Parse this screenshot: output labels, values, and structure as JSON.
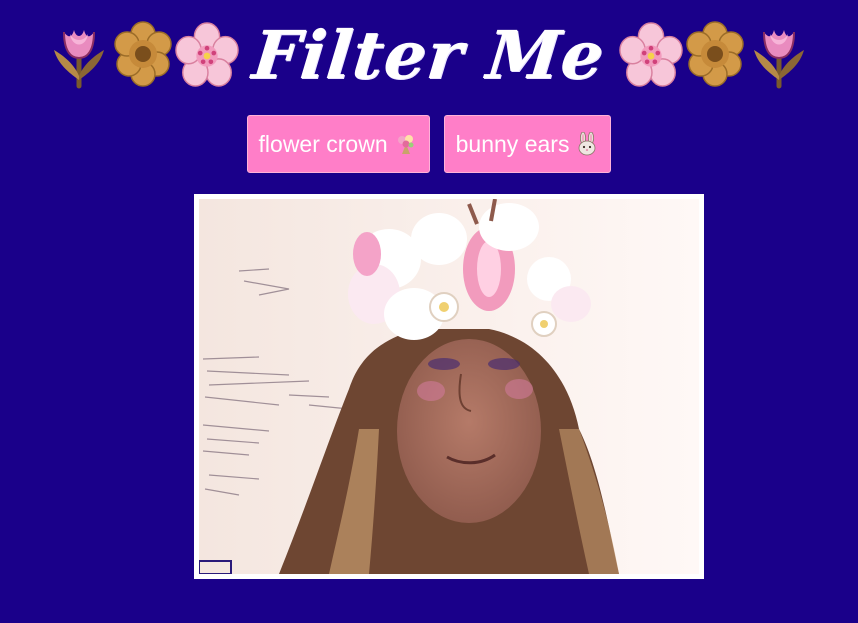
{
  "app": {
    "title": "Filter Me"
  },
  "header": {
    "left_decorations": [
      "tulip-icon",
      "blossom-icon",
      "cherry-blossom-icon"
    ],
    "right_decorations": [
      "cherry-blossom-icon",
      "blossom-icon",
      "tulip-icon"
    ]
  },
  "filters": {
    "flower_crown": {
      "label": "flower crown",
      "icon": "bouquet-icon"
    },
    "bunny_ears": {
      "label": "bunny ears",
      "icon": "rabbit-face-icon"
    }
  },
  "video": {
    "active_filter": "flower crown"
  },
  "colors": {
    "background": "#1a008a",
    "button": "#ff7ec8",
    "title": "#ffffff",
    "frame": "#ffffff"
  }
}
